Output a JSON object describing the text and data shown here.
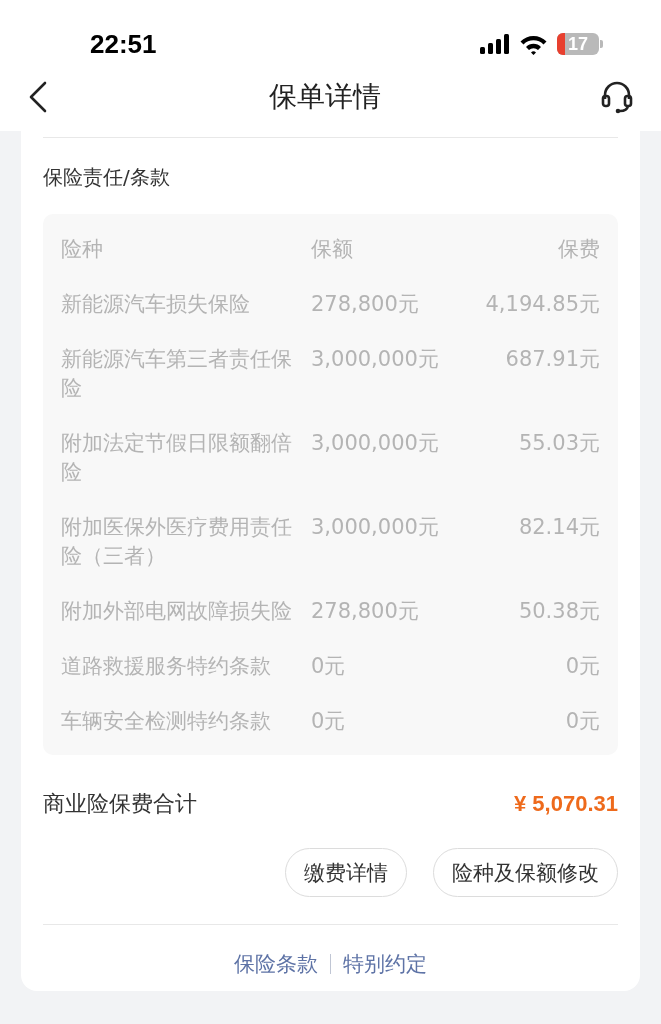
{
  "status_bar": {
    "time": "22:51",
    "battery": "17"
  },
  "nav": {
    "title": "保单详情"
  },
  "section": {
    "title": "保险责任/条款",
    "columns": [
      "险种",
      "保额",
      "保费"
    ],
    "rows": [
      {
        "name": "新能源汽车损失保险",
        "amount": "278,800元",
        "premium": "4,194.85元"
      },
      {
        "name": "新能源汽车第三者责任保险",
        "amount": "3,000,000元",
        "premium": "687.91元"
      },
      {
        "name": "附加法定节假日限额翻倍险",
        "amount": "3,000,000元",
        "premium": "55.03元"
      },
      {
        "name": "附加医保外医疗费用责任险（三者）",
        "amount": "3,000,000元",
        "premium": "82.14元"
      },
      {
        "name": "附加外部电网故障损失险",
        "amount": "278,800元",
        "premium": "50.38元"
      },
      {
        "name": "道路救援服务特约条款",
        "amount": "0元",
        "premium": "0元"
      },
      {
        "name": "车辆安全检测特约条款",
        "amount": "0元",
        "premium": "0元"
      }
    ]
  },
  "total": {
    "label": "商业险保费合计",
    "value": "¥ 5,070.31"
  },
  "buttons": [
    "缴费详情",
    "险种及保额修改"
  ],
  "links": [
    "保险条款",
    "特别约定"
  ]
}
